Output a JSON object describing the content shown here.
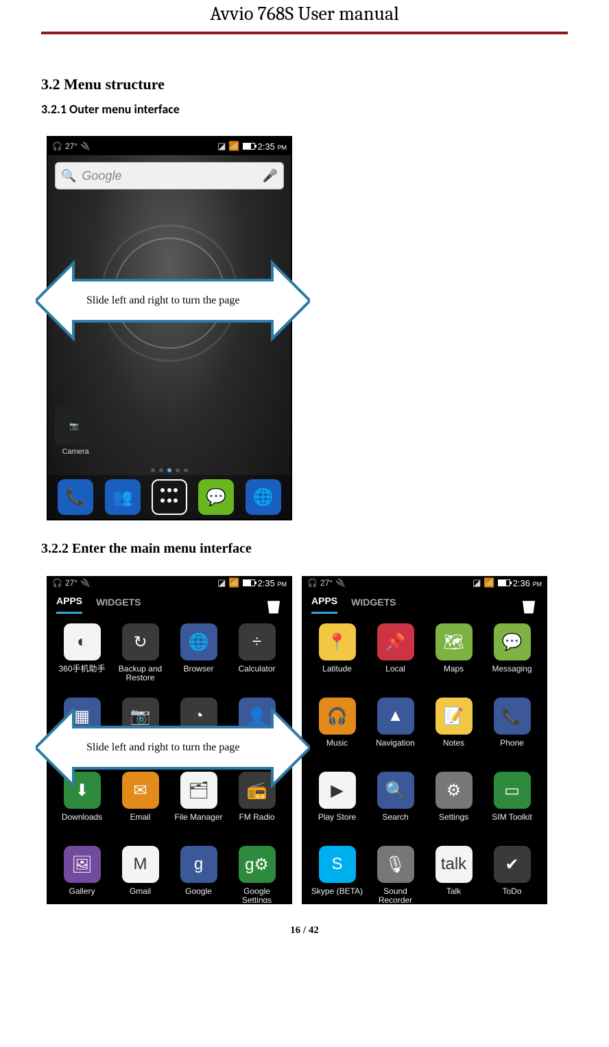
{
  "doc": {
    "title": "Avvio 768S User manual",
    "footer": "16 / 42"
  },
  "sections": {
    "s32": "3.2 Menu structure",
    "s321": "3.2.1 Outer menu interface",
    "s322": "3.2.2 Enter the main menu interface"
  },
  "callouts": {
    "slide1": "Slide left and right to turn the page",
    "slide2": "Slide  left  and  right  to  turn  the page"
  },
  "status": {
    "time1": "2:35",
    "pm": "PM",
    "time2": "2:35",
    "time3": "2:36",
    "temp": "27°",
    "signal_label": "1"
  },
  "home": {
    "search_placeholder": "Google",
    "camera_label": "Camera"
  },
  "drawer": {
    "tab_apps": "APPS",
    "tab_widgets": "WIDGETS"
  },
  "apps_page1": [
    {
      "label": "360手机助手",
      "color": "c-w",
      "glyph": "◐"
    },
    {
      "label": "Backup and Restore",
      "color": "c-d",
      "glyph": "↻"
    },
    {
      "label": "Browser",
      "color": "c-b",
      "glyph": "🌐"
    },
    {
      "label": "Calculator",
      "color": "c-d",
      "glyph": "÷"
    },
    {
      "label": "Calendar",
      "color": "c-b",
      "glyph": "▦"
    },
    {
      "label": "Camera",
      "color": "c-d",
      "glyph": "📷"
    },
    {
      "label": "Clock",
      "color": "c-d",
      "glyph": "◔"
    },
    {
      "label": "Contacts",
      "color": "c-b",
      "glyph": "👤"
    },
    {
      "label": "Downloads",
      "color": "c-g",
      "glyph": "⬇"
    },
    {
      "label": "Email",
      "color": "c-o",
      "glyph": "✉"
    },
    {
      "label": "File Manager",
      "color": "c-w",
      "glyph": "🗂"
    },
    {
      "label": "FM Radio",
      "color": "c-d",
      "glyph": "📻"
    },
    {
      "label": "Gallery",
      "color": "c-p",
      "glyph": "🖼"
    },
    {
      "label": "Gmail",
      "color": "c-w",
      "glyph": "M"
    },
    {
      "label": "Google",
      "color": "c-b",
      "glyph": "g"
    },
    {
      "label": "Google Settings",
      "color": "c-g",
      "glyph": "g⚙"
    }
  ],
  "apps_page2": [
    {
      "label": "Latitude",
      "color": "c-y",
      "glyph": "📍"
    },
    {
      "label": "Local",
      "color": "c-r",
      "glyph": "📌"
    },
    {
      "label": "Maps",
      "color": "c-lg",
      "glyph": "🗺"
    },
    {
      "label": "Messaging",
      "color": "c-lg",
      "glyph": "💬"
    },
    {
      "label": "Music",
      "color": "c-o",
      "glyph": "🎧"
    },
    {
      "label": "Navigation",
      "color": "c-b",
      "glyph": "▲"
    },
    {
      "label": "Notes",
      "color": "c-y",
      "glyph": "📝"
    },
    {
      "label": "Phone",
      "color": "c-b",
      "glyph": "📞"
    },
    {
      "label": "Play Store",
      "color": "c-w",
      "glyph": "▶"
    },
    {
      "label": "Search",
      "color": "c-b",
      "glyph": "🔍"
    },
    {
      "label": "Settings",
      "color": "c-gr",
      "glyph": "⚙"
    },
    {
      "label": "SIM Toolkit",
      "color": "c-g",
      "glyph": "▭"
    },
    {
      "label": "Skype (BETA)",
      "color": "c-sky",
      "glyph": "S"
    },
    {
      "label": "Sound Recorder",
      "color": "c-gr",
      "glyph": "🎙"
    },
    {
      "label": "Talk",
      "color": "c-w",
      "glyph": "talk"
    },
    {
      "label": "ToDo",
      "color": "c-d",
      "glyph": "✔"
    }
  ]
}
